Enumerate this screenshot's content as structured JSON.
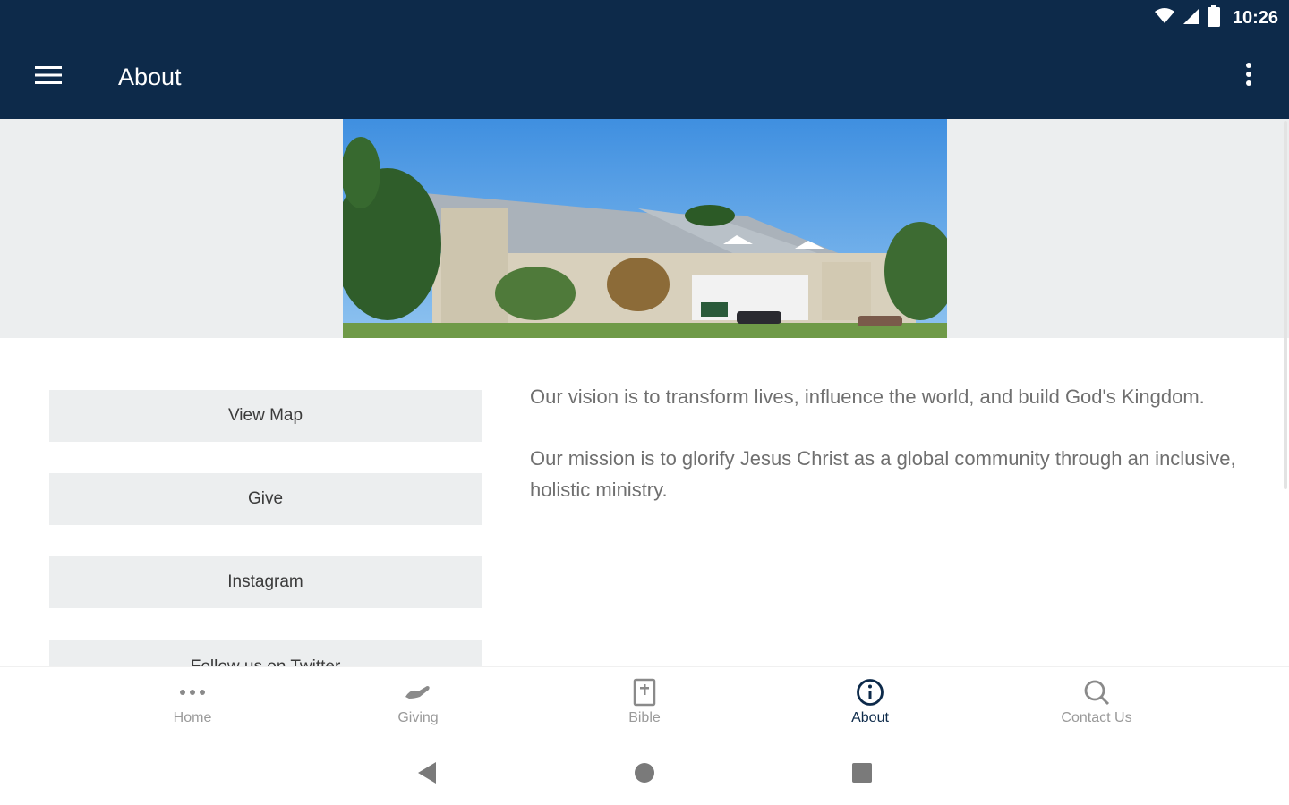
{
  "status_bar": {
    "time": "10:26",
    "icons": [
      "wifi-icon",
      "signal-icon",
      "battery-icon"
    ]
  },
  "app_bar": {
    "title": "About",
    "menu_icon": "hamburger-menu-icon",
    "overflow_icon": "more-vert-icon",
    "color": "#0d2a4a"
  },
  "actions": [
    {
      "label": "View Map"
    },
    {
      "label": "Give"
    },
    {
      "label": "Instagram"
    },
    {
      "label": "Follow us on Twitter"
    }
  ],
  "about": {
    "vision": "Our vision is to transform lives, influence the world, and build God's Kingdom.",
    "mission": "Our mission is to glorify Jesus Christ as a global community through an inclusive, holistic ministry."
  },
  "bottom_nav": [
    {
      "label": "Home",
      "icon": "more-horiz-icon",
      "active": false
    },
    {
      "label": "Giving",
      "icon": "giving-hand-icon",
      "active": false
    },
    {
      "label": "Bible",
      "icon": "bible-icon",
      "active": false
    },
    {
      "label": "About",
      "icon": "info-icon",
      "active": true
    },
    {
      "label": "Contact Us",
      "icon": "search-icon",
      "active": false
    }
  ],
  "system_nav": [
    "back-icon",
    "home-circle-icon",
    "recents-square-icon"
  ]
}
